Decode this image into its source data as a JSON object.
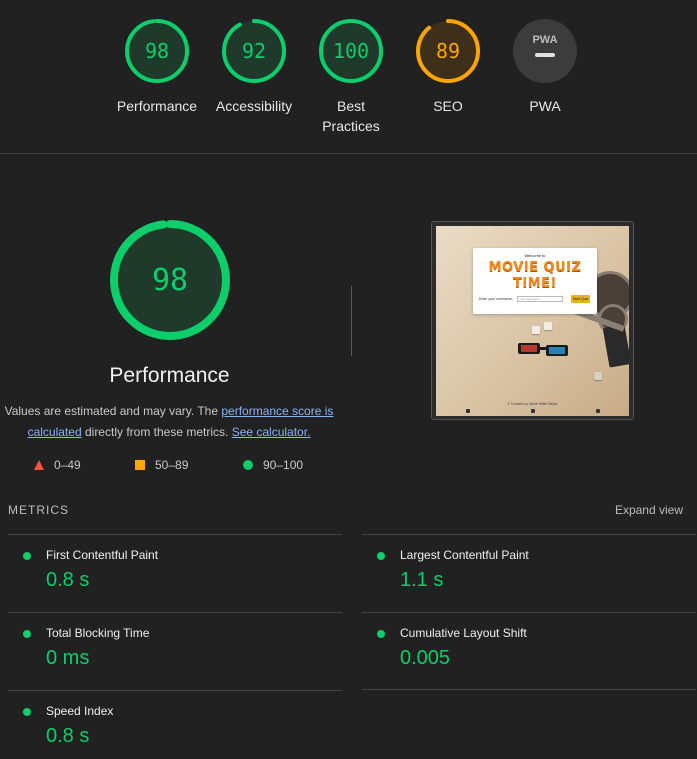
{
  "gauges": [
    {
      "score": "98",
      "label": "Performance",
      "status": "pass"
    },
    {
      "score": "92",
      "label": "Accessibility",
      "status": "pass"
    },
    {
      "score": "100",
      "label": "Best Practices",
      "status": "pass"
    },
    {
      "score": "89",
      "label": "SEO",
      "status": "average"
    },
    {
      "score": null,
      "label": "PWA",
      "status": "na",
      "badge": "PWA"
    }
  ],
  "gauge_fill_fraction": {
    "performance": 0.98,
    "accessibility": 0.92,
    "best_practices": 1.0,
    "seo": 0.89
  },
  "main": {
    "score": "98",
    "title": "Performance",
    "note_prefix": "Values are estimated and may vary. The ",
    "note_link1": "performance score is calculated",
    "note_middle": " directly from these metrics. ",
    "note_link2": "See calculator."
  },
  "legend": {
    "fail": "0–49",
    "average": "50–89",
    "pass": "90–100"
  },
  "thumbnail": {
    "welcome": "Welcome to",
    "title": "MOVIE QUIZ TIME!",
    "username_label": "Enter your username:",
    "username_placeholder": "Your Username",
    "start_button": "Start Quiz",
    "footer": "© Created by Marie Hillier Beyer"
  },
  "metrics": {
    "header": "METRICS",
    "expand": "Expand view",
    "items": [
      {
        "name": "First Contentful Paint",
        "value": "0.8 s"
      },
      {
        "name": "Largest Contentful Paint",
        "value": "1.1 s"
      },
      {
        "name": "Total Blocking Time",
        "value": "0 ms"
      },
      {
        "name": "Cumulative Layout Shift",
        "value": "0.005"
      },
      {
        "name": "Speed Index",
        "value": "0.8 s"
      }
    ]
  },
  "colors": {
    "pass": "#0cce6b",
    "average": "#ffa400",
    "fail": "#ff4e42",
    "na": "#9e9e9e",
    "background": "#212121"
  }
}
